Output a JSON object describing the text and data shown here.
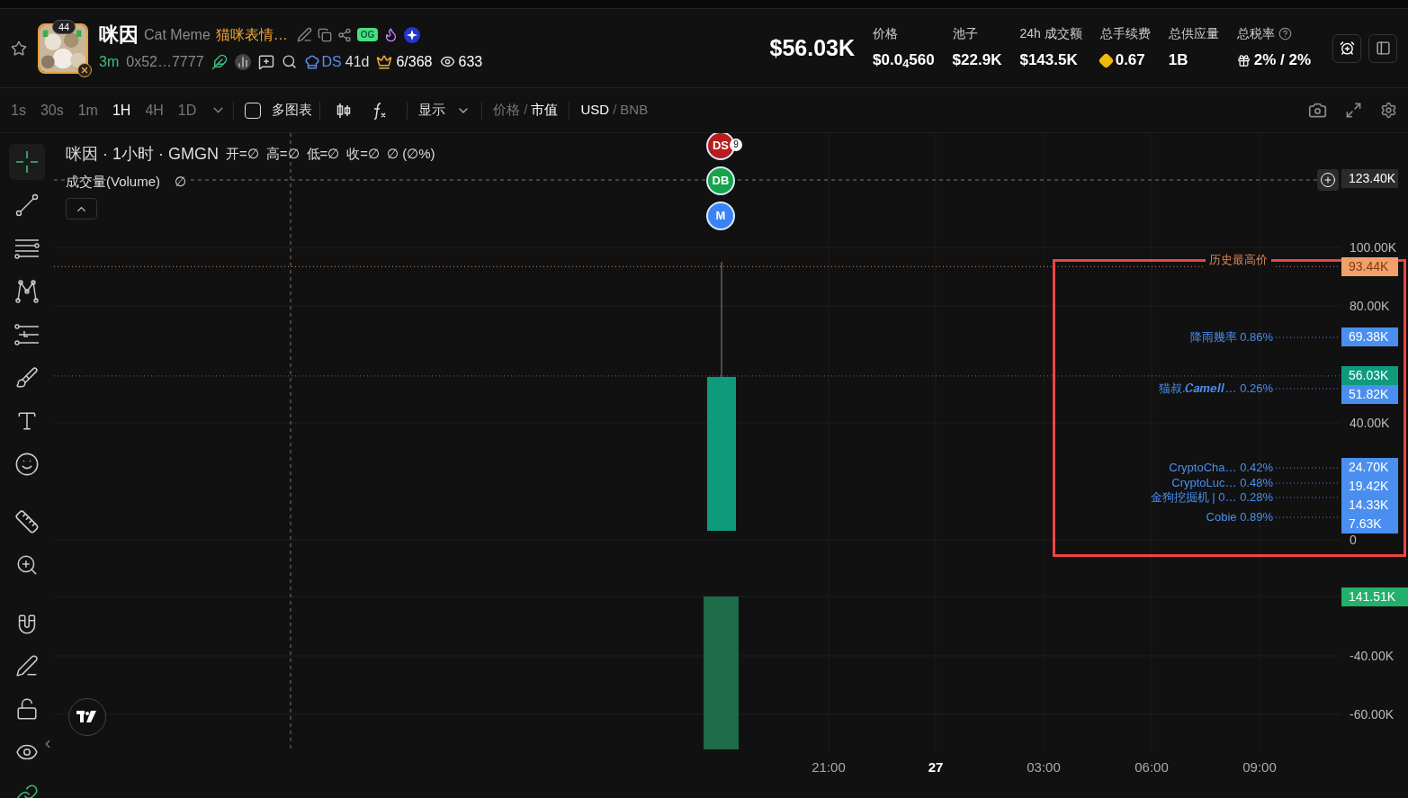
{
  "token": {
    "name": "咪因",
    "symbol": "Cat Meme",
    "description": "猫咪表情…",
    "avatar_count": "44",
    "og_label": "OG",
    "age": "3m",
    "address": "0x52…7777",
    "dev_label": "DS",
    "dev_age": "41d",
    "rank": "6/368",
    "views": "633"
  },
  "market_cap": "$56.03K",
  "stats": [
    {
      "label": "价格",
      "value": "$0.0$_{4}$560",
      "kind": "plain",
      "help": false
    },
    {
      "label": "池子",
      "value": "$22.9K",
      "kind": "plain",
      "help": false
    },
    {
      "label": "24h 成交额",
      "value": "$143.5K",
      "kind": "plain",
      "help": false
    },
    {
      "label": "总手续费",
      "value": "0.67",
      "kind": "bnb",
      "help": false
    },
    {
      "label": "总供应量",
      "value": "1B",
      "kind": "plain",
      "help": false
    },
    {
      "label": "总税率",
      "value": "2% / 2%",
      "kind": "gift",
      "help": true
    }
  ],
  "toolbar": {
    "timeframes": [
      {
        "label": "1s",
        "selected": false
      },
      {
        "label": "30s",
        "selected": false
      },
      {
        "label": "1m",
        "selected": false
      },
      {
        "label": "1H",
        "selected": true
      },
      {
        "label": "4H",
        "selected": false
      },
      {
        "label": "1D",
        "selected": false
      }
    ],
    "multi_chart": {
      "label": "多图表",
      "checked": false
    },
    "display": "显示",
    "separator": "/",
    "value_modes": [
      {
        "label": "价格",
        "selected": false
      },
      {
        "label": "市值",
        "selected": true
      }
    ],
    "currencies": [
      {
        "label": "USD",
        "selected": true
      },
      {
        "label": "BNB",
        "selected": false
      }
    ]
  },
  "chart": {
    "legend_title": "咪因 · 1小时 · GMGN",
    "ohlc": [
      "开=∅",
      "高=∅",
      "低=∅",
      "收=∅"
    ],
    "change": "∅ (∅%)",
    "volume_label": "成交量(Volume)",
    "volume_value": "∅",
    "markers": [
      {
        "label": "DS",
        "count": "9",
        "color": "#b91c1c"
      },
      {
        "label": "DB",
        "color": "#16a34a"
      },
      {
        "label": "M",
        "color": "#3b82f6"
      }
    ],
    "price_ticks": [
      "100.00K",
      "80.00K",
      "40.00K",
      "0"
    ],
    "crosshair_price": "123.40K",
    "ath": {
      "caption": "历史最高价",
      "price": "93.44K"
    },
    "current_price": "56.03K",
    "holders": [
      {
        "name": "降雨幾率",
        "share": "0.86%",
        "price": "69.38K"
      },
      {
        "name": "猫叔.𝑪𝒂𝒎𝒆𝒍𝒍…",
        "share": "0.26%",
        "price": "51.82K"
      },
      {
        "name": "CryptoCha…",
        "share": "0.42%",
        "price": "24.70K"
      },
      {
        "name": "CryptoLuc…",
        "share": "0.48%",
        "price": "19.42K"
      },
      {
        "name": "金狗挖掘机 | 0…",
        "share": "0.28%",
        "price": "14.33K"
      },
      {
        "name": "Cobie",
        "share": "0.89%",
        "price": "7.63K"
      }
    ],
    "volume_price": "141.51K",
    "volume_ticks": [
      "-40.00K",
      "-60.00K"
    ],
    "time_labels": [
      {
        "label": "21:00",
        "kind": "time"
      },
      {
        "label": "27",
        "kind": "day"
      },
      {
        "label": "03:00",
        "kind": "time"
      },
      {
        "label": "06:00",
        "kind": "time"
      },
      {
        "label": "09:00",
        "kind": "time"
      }
    ],
    "highlight": true
  }
}
